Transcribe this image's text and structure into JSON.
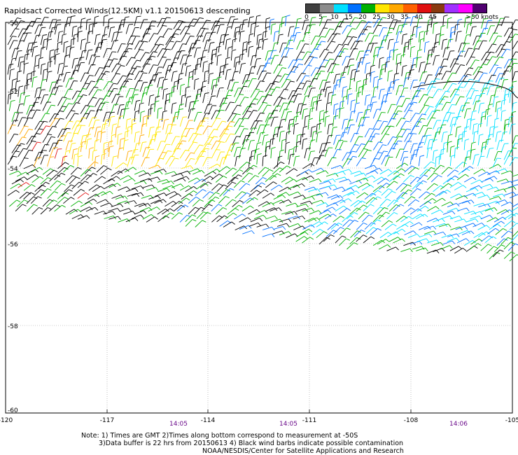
{
  "title": "Rapidsact Corrected Winds(12.5KM) v1.1 20150613 descending",
  "legend": {
    "colors": [
      "#404040",
      "#8c8c8c",
      "#00e0ff",
      "#0070ff",
      "#00b000",
      "#ffe600",
      "#ffa800",
      "#ff6000",
      "#e01010",
      "#8a3a10",
      "#a030ff",
      "#ff00ff",
      "#500070"
    ],
    "labels": [
      "0",
      "5",
      "10",
      "15",
      "20",
      "25",
      "30",
      "35",
      "40",
      "45",
      ">50 knots"
    ]
  },
  "map": {
    "lat_labels": [
      "-50",
      "-52",
      "-54",
      "-56",
      "-58",
      "-60"
    ],
    "lon_labels": [
      "-120",
      "-117",
      "-114",
      "-111",
      "-108",
      "-105"
    ],
    "times": [
      "14:05",
      "14:05",
      "14:06"
    ],
    "grid_line": "dotted"
  },
  "footer": {
    "line1": "Note: 1) Times are GMT 2)Times along bottom correspond to measurement at -50S",
    "line2": "3)Data buffer is 22 hrs from 20150613 4) Black wind barbs indicate possible contamination",
    "line3": "NOAA/NESDIS/Center for Satellite Applications and Research"
  }
}
